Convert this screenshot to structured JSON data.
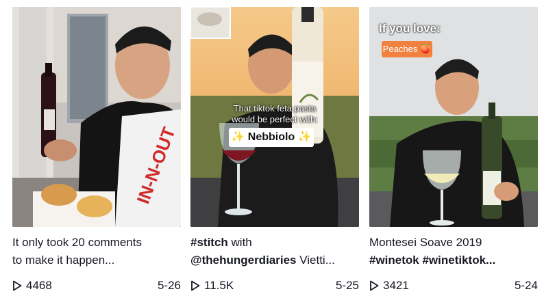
{
  "videos": [
    {
      "caption_line1": "It only took 20 comments",
      "caption_line2": "to make it happen...",
      "plays": "4468",
      "date": "5-26"
    },
    {
      "caption_line1_tag": "#stitch",
      "caption_line1_rest": " with",
      "caption_line2_mention": "@thehungerdiaries",
      "caption_line2_rest": " Vietti...",
      "overlay_text_1": "That tiktok feta pasta",
      "overlay_text_2": "would be perfect with:",
      "overlay_tag": "✨ Nebbiolo ✨",
      "plays": "11.5K",
      "date": "5-25"
    },
    {
      "caption_line1": "Montesei Soave 2019",
      "caption_line2": "#winetok #winetiktok...",
      "overlay_heading": "If you love:",
      "overlay_tag": "Peaches 🍑",
      "plays": "3421",
      "date": "5-24"
    }
  ],
  "colors": {
    "text": "#161823",
    "peach_tag": "#f0813f"
  },
  "icons": {
    "play": "play-icon"
  }
}
